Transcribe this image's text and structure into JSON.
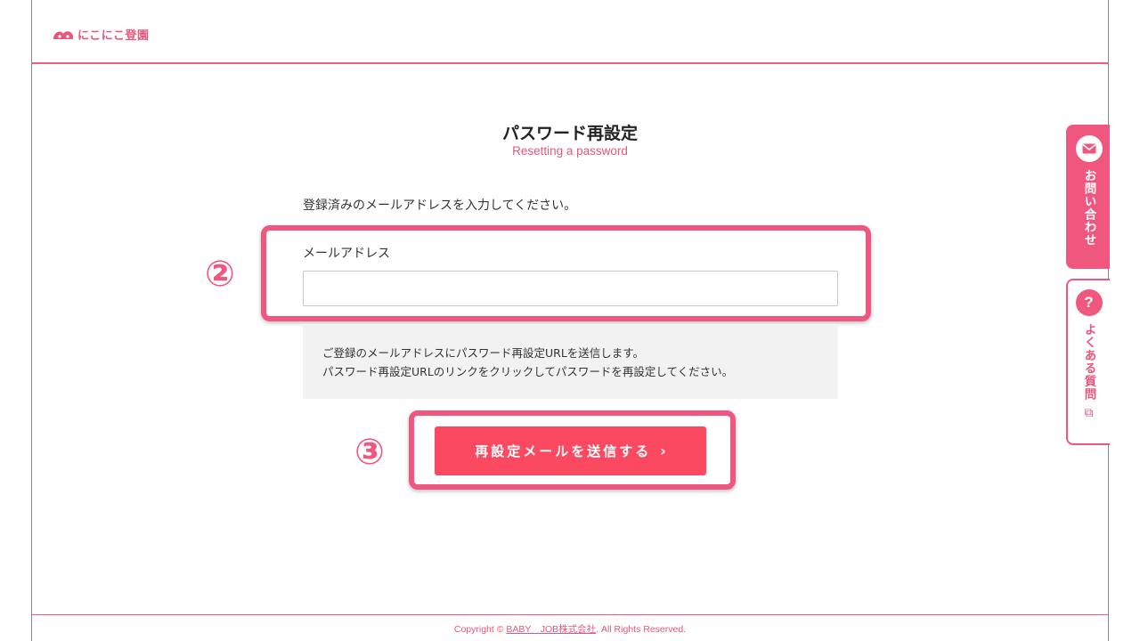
{
  "header": {
    "logo_text": "にこにこ登園"
  },
  "page": {
    "title": "パスワード再設定",
    "subtitle": "Resetting a password",
    "intro": "登録済みのメールアドレスを入力してください。"
  },
  "form": {
    "email_label": "メールアドレス",
    "email_value": "",
    "email_placeholder": ""
  },
  "notice": {
    "line1": "ご登録のメールアドレスにパスワード再設定URLを送信します。",
    "line2": "パスワード再設定URLのリンクをクリックしてパスワードを再設定してください。"
  },
  "submit": {
    "label": "再設定メールを送信する",
    "chevron": "›"
  },
  "annotations": {
    "step2": "②",
    "step3": "③"
  },
  "side_tabs": {
    "contact": {
      "label": "お問い合わせ",
      "icon": "mail-icon"
    },
    "faq": {
      "label": "よくある質問",
      "icon": "question-icon",
      "icon_glyph": "?",
      "external_icon": "external-link-icon",
      "external_glyph": "⧉"
    }
  },
  "footer": {
    "prefix": "Copyright © ",
    "company": "BABY　JOB株式会社",
    "suffix": ". All Rights Reserved."
  },
  "colors": {
    "accent": "#f0577f",
    "button": "#fb4961",
    "notice_bg": "#f2f2f2"
  }
}
